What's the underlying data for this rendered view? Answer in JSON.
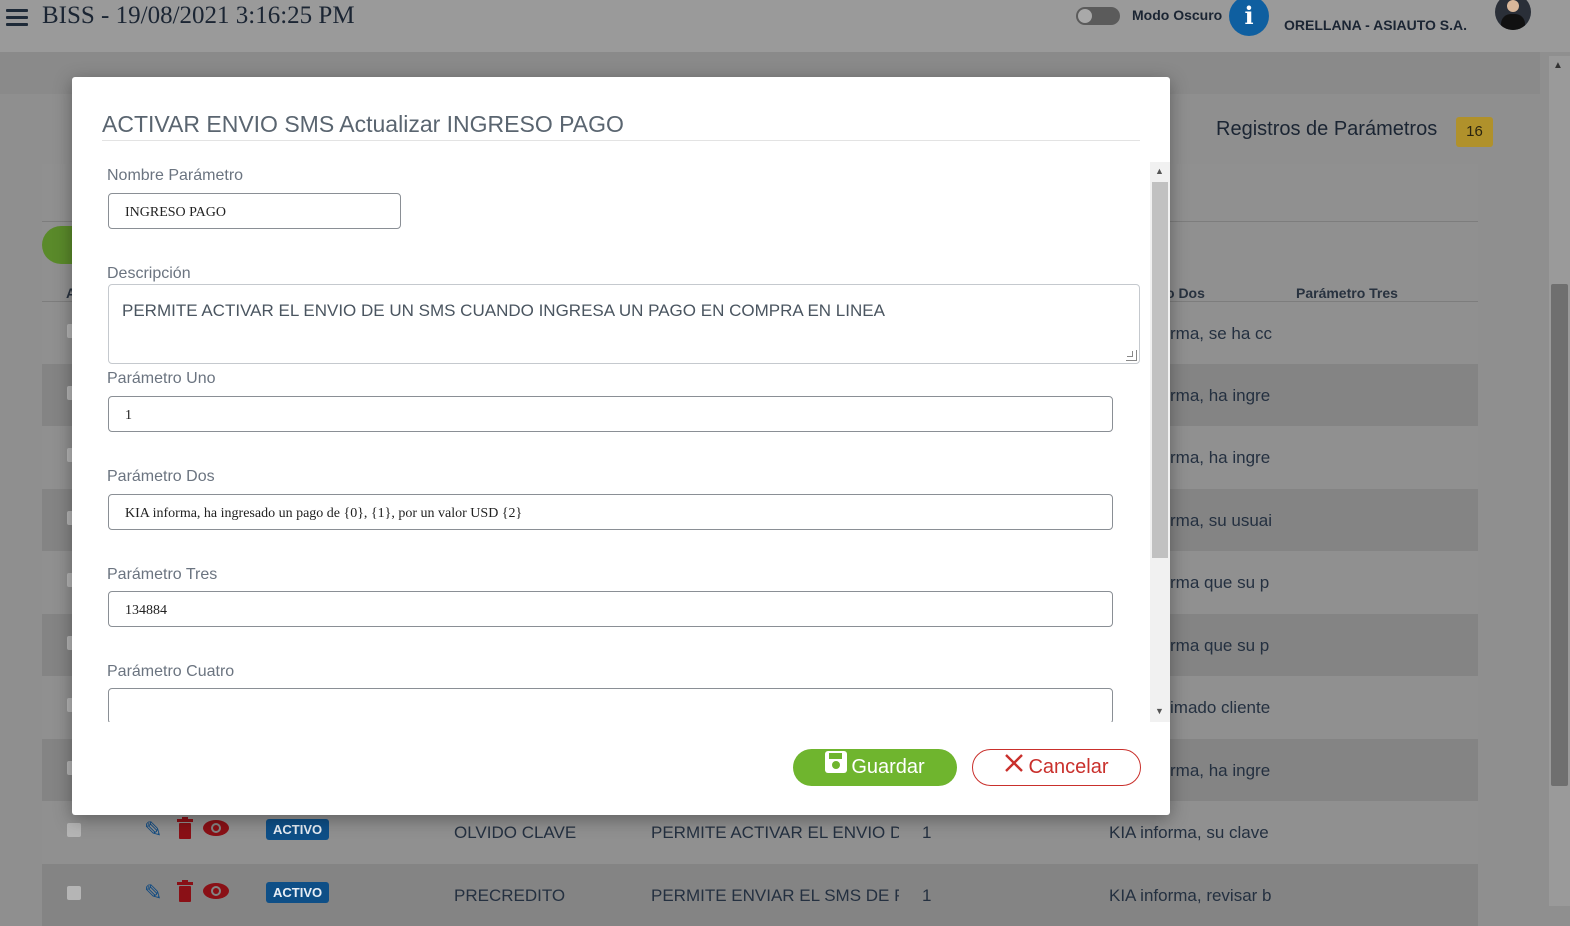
{
  "header": {
    "app_title": "BISS - 19/08/2021 3:16:25 PM",
    "dark_mode_label": "Modo Oscuro",
    "info_icon_glyph": "i",
    "company": "ORELLANA - ASIAUTO S.A."
  },
  "records": {
    "title": "Registros de Parámetros",
    "count": "16"
  },
  "table": {
    "col_a": "A",
    "col_dos": "o Dos",
    "col_tres": "Parámetro Tres",
    "rows_right": [
      "rma, se ha cc",
      "rma, ha ingre",
      "rma, ha ingre",
      "rma, su usuai",
      "rma que su p",
      "rma que su p",
      "imado cliente",
      "rma, ha ingre"
    ],
    "full_rows": [
      {
        "status": "ACTIVO",
        "name": "OLVIDO CLAVE",
        "description": "PERMITE ACTIVAR EL ENVIO DE",
        "param1": "1",
        "param2": "KIA informa, su clave"
      },
      {
        "status": "ACTIVO",
        "name": "PRECREDITO",
        "description": "PERMITE ENVIAR EL SMS DE PF",
        "param1": "1",
        "param2": "KIA informa, revisar b"
      }
    ]
  },
  "modal": {
    "title": "ACTIVAR ENVIO SMS Actualizar INGRESO PAGO",
    "fields": {
      "nombre_label": "Nombre Parámetro",
      "nombre_value": "INGRESO PAGO",
      "descripcion_label": "Descripción",
      "descripcion_value": "PERMITE ACTIVAR EL ENVIO DE UN SMS CUANDO INGRESA UN PAGO EN COMPRA EN LINEA",
      "uno_label": "Parámetro Uno",
      "uno_value": "1",
      "dos_label": "Parámetro Dos",
      "dos_value": "KIA informa, ha ingresado un pago de {0}, {1}, por un valor USD {2}",
      "tres_label": "Parámetro Tres",
      "tres_value": "134884",
      "cuatro_label": "Parámetro Cuatro",
      "cuatro_value": ""
    },
    "save_label": "Guardar",
    "cancel_label": "Cancelar"
  },
  "colors": {
    "save_green": "#6fb52e",
    "cancel_red": "#c9302c",
    "status_blue": "#0e4f87",
    "badge_gold": "#b0912b"
  },
  "icons": [
    "hamburger-icon",
    "info-icon",
    "floppy-icon",
    "close-x-icon",
    "pencil-icon",
    "trash-icon",
    "eye-icon"
  ]
}
